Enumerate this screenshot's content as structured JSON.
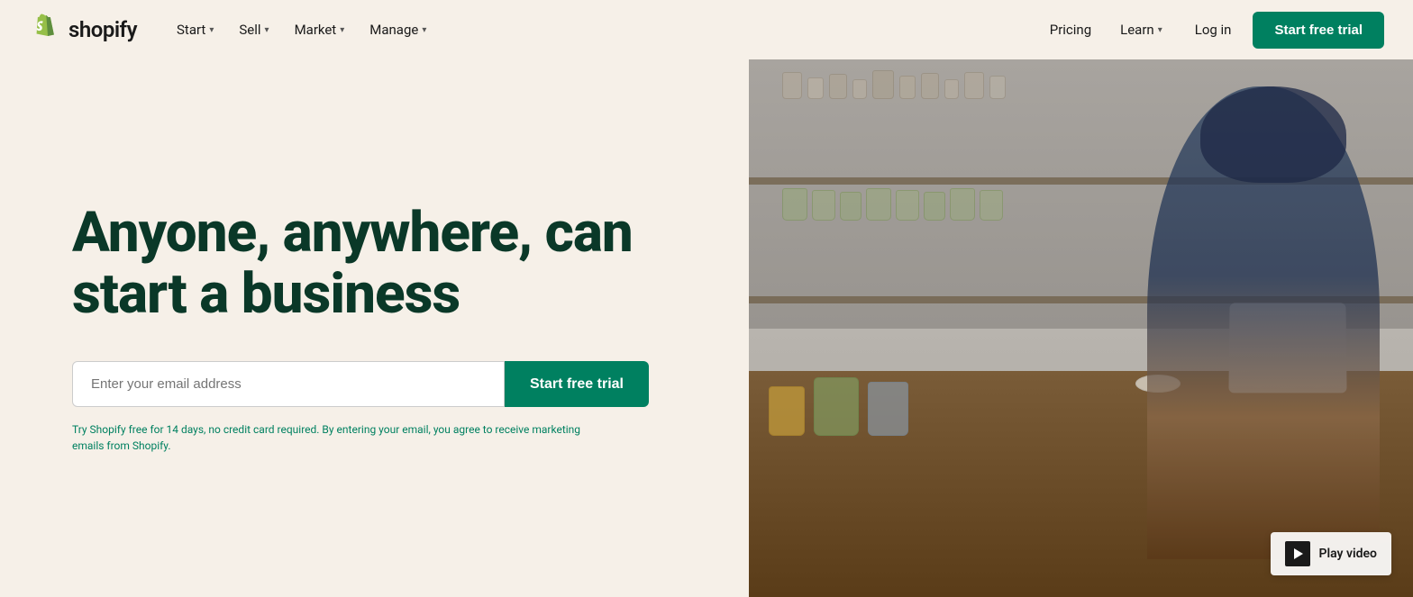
{
  "brand": {
    "name": "shopify",
    "logo_alt": "Shopify logo"
  },
  "navbar": {
    "nav_items": [
      {
        "label": "Start",
        "has_dropdown": true
      },
      {
        "label": "Sell",
        "has_dropdown": true
      },
      {
        "label": "Market",
        "has_dropdown": true
      },
      {
        "label": "Manage",
        "has_dropdown": true
      }
    ],
    "right_items": [
      {
        "label": "Pricing",
        "has_dropdown": false
      },
      {
        "label": "Learn",
        "has_dropdown": true
      },
      {
        "label": "Log in",
        "has_dropdown": false
      }
    ],
    "cta_label": "Start free trial"
  },
  "hero": {
    "heading_line1": "Anyone, anywhere, can",
    "heading_line2": "start a business",
    "email_placeholder": "Enter your email address",
    "cta_label": "Start free trial",
    "disclaimer": "Try Shopify free for 14 days, no credit card required. By entering your email, you agree to receive marketing emails from Shopify."
  },
  "video": {
    "label": "Play video"
  }
}
